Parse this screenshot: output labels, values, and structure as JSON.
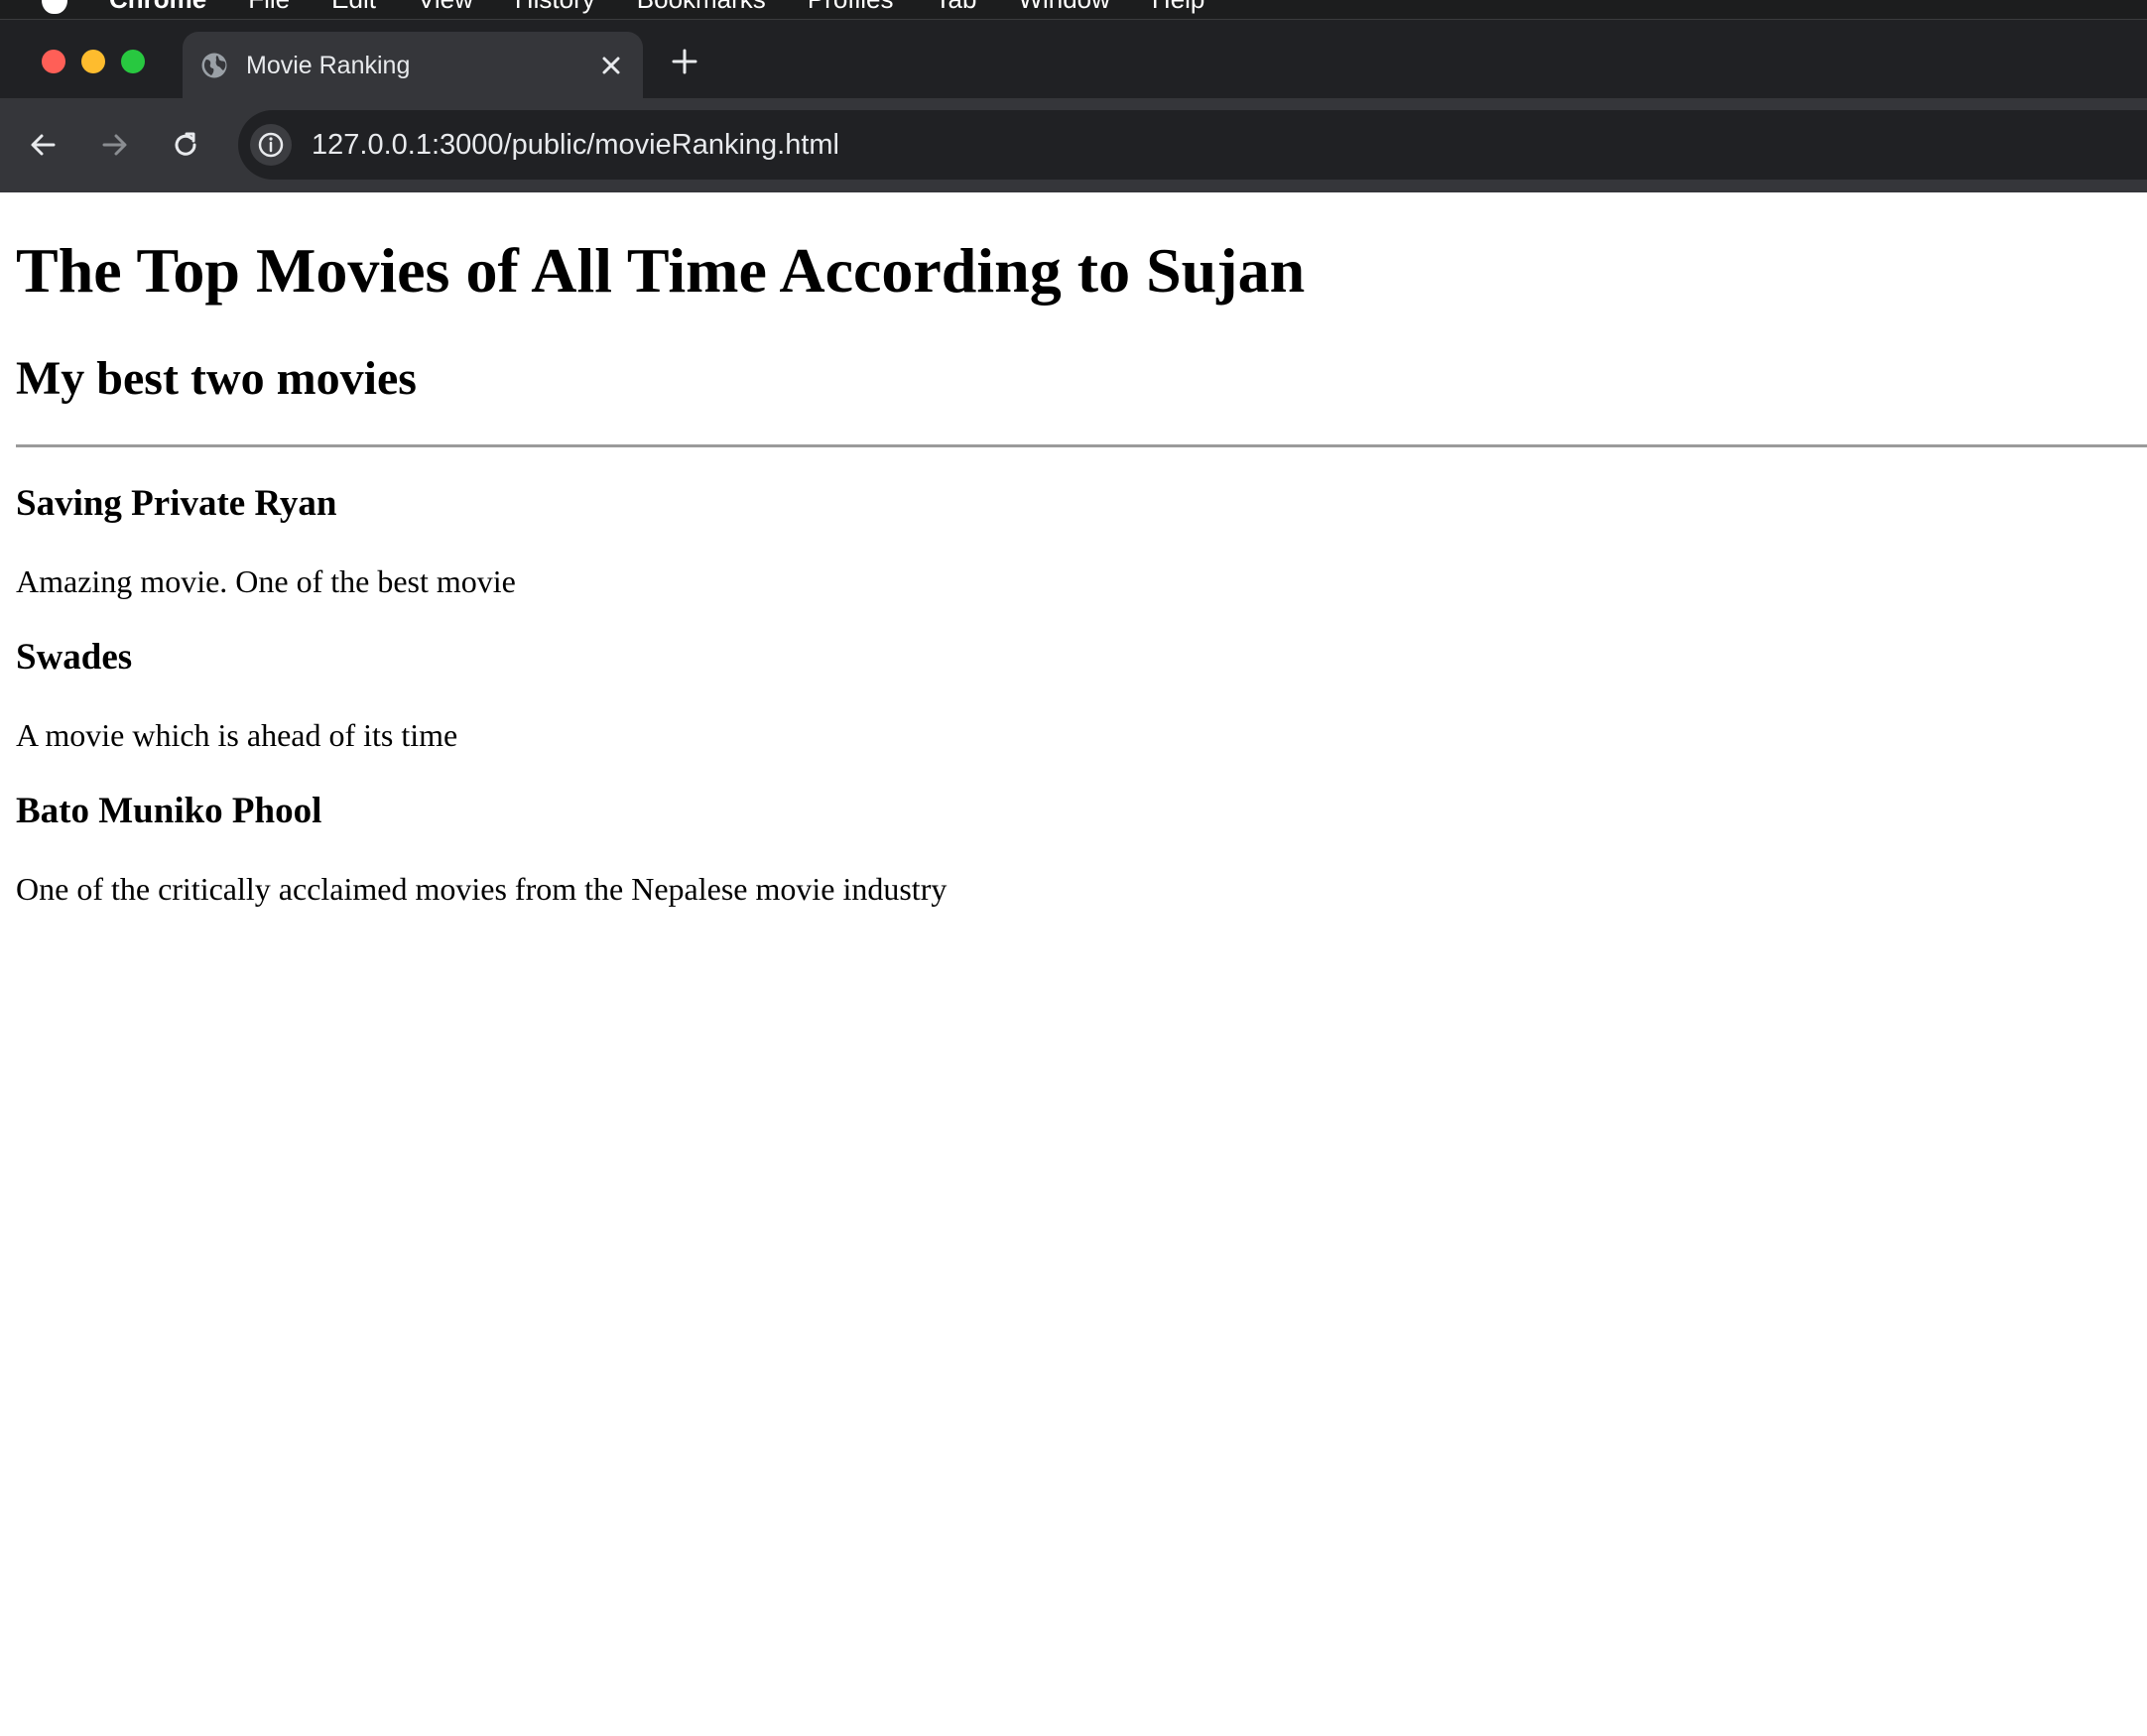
{
  "menubar": {
    "app_name": "Chrome",
    "items": [
      "File",
      "Edit",
      "View",
      "History",
      "Bookmarks",
      "Profiles",
      "Tab",
      "Window",
      "Help"
    ]
  },
  "browser": {
    "tab": {
      "title": "Movie Ranking",
      "icon": "globe-icon",
      "close_icon": "close-icon"
    },
    "new_tab_icon": "plus-icon",
    "toolbar": {
      "back_icon": "arrow-left-icon",
      "forward_icon": "arrow-right-icon",
      "reload_icon": "reload-icon",
      "site_info_icon": "info-icon",
      "url": "127.0.0.1:3000/public/movieRanking.html"
    }
  },
  "page": {
    "heading": "The Top Movies of All Time According to Sujan",
    "subheading": "My best two movies",
    "movies": [
      {
        "title": "Saving Private Ryan",
        "description": "Amazing movie. One of the best movie"
      },
      {
        "title": "Swades",
        "description": "A movie which is ahead of its time"
      },
      {
        "title": "Bato Muniko Phool",
        "description": "One of the critically acclaimed movies from the Nepalese movie industry"
      }
    ]
  },
  "colors": {
    "traffic_red": "#ff5f57",
    "traffic_yellow": "#febc2e",
    "traffic_green": "#28c840",
    "chrome_dark": "#202124",
    "chrome_tab": "#35363a"
  }
}
